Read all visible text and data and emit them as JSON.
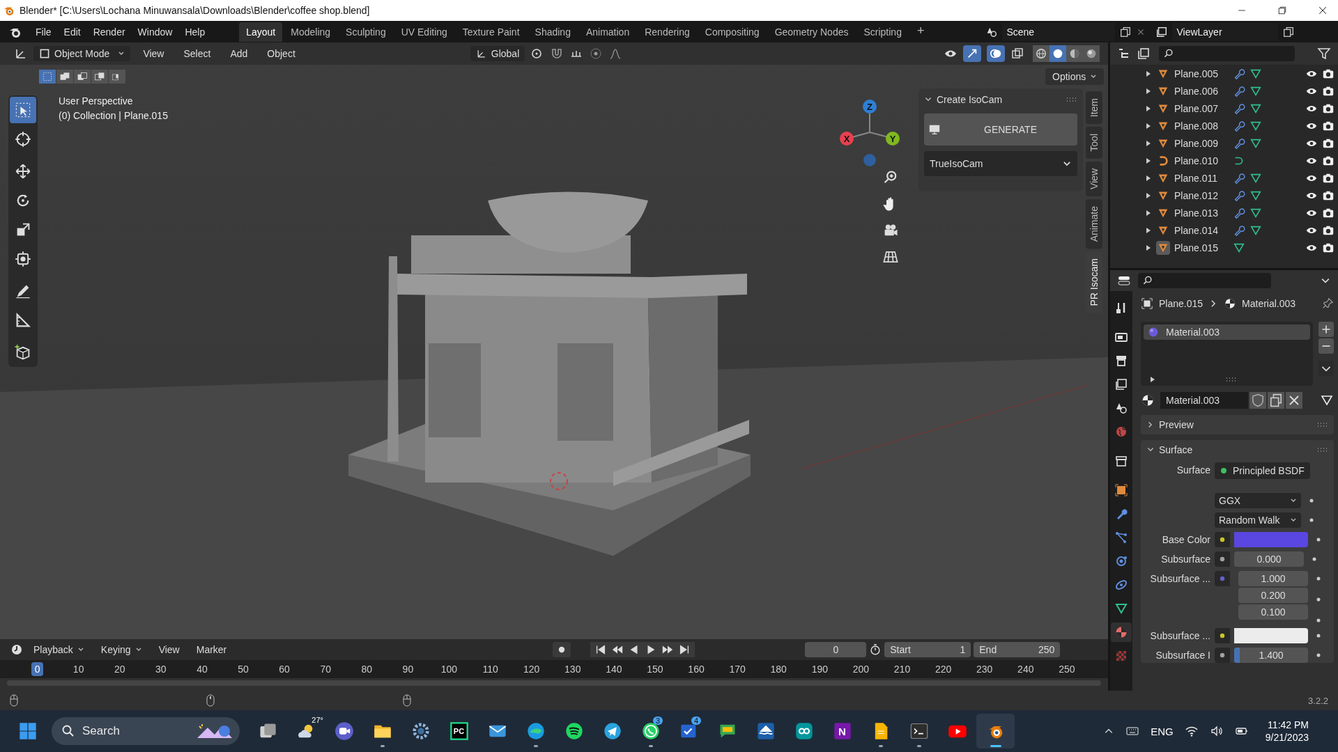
{
  "title_bar": {
    "title": "Blender* [C:\\Users\\Lochana Minuwansala\\Downloads\\Blender\\coffee shop.blend]"
  },
  "menu": [
    "File",
    "Edit",
    "Render",
    "Window",
    "Help"
  ],
  "workspaces": [
    {
      "label": "Layout",
      "selected": true
    },
    {
      "label": "Modeling",
      "selected": false
    },
    {
      "label": "Sculpting",
      "selected": false
    },
    {
      "label": "UV Editing",
      "selected": false
    },
    {
      "label": "Texture Paint",
      "selected": false
    },
    {
      "label": "Shading",
      "selected": false
    },
    {
      "label": "Animation",
      "selected": false
    },
    {
      "label": "Rendering",
      "selected": false
    },
    {
      "label": "Compositing",
      "selected": false
    },
    {
      "label": "Geometry Nodes",
      "selected": false
    },
    {
      "label": "Scripting",
      "selected": false
    }
  ],
  "add_workspace": "+",
  "scene": "Scene",
  "view_layer": "ViewLayer",
  "viewport_header": {
    "mode": "Object Mode",
    "menus": [
      "View",
      "Select",
      "Add",
      "Object"
    ],
    "orientation": "Global",
    "shading": [
      {
        "kind": "wireframe",
        "selected": false
      },
      {
        "kind": "solid",
        "selected": true
      },
      {
        "kind": "material",
        "selected": false
      },
      {
        "kind": "rendered",
        "selected": false
      }
    ]
  },
  "viewport": {
    "select_modes": [
      {
        "kind": "set",
        "selected": true
      },
      {
        "kind": "extend",
        "selected": false
      },
      {
        "kind": "subtract",
        "selected": false
      },
      {
        "kind": "invert",
        "selected": false
      },
      {
        "kind": "intersect",
        "selected": false
      }
    ],
    "options": "Options",
    "perspective": "User Perspective",
    "collection": "(0) Collection | Plane.015",
    "tools": [
      {
        "kind": "select",
        "selected": true
      },
      {
        "kind": "cursor",
        "selected": false
      },
      {
        "kind": "move",
        "selected": false
      },
      {
        "kind": "rotate",
        "selected": false
      },
      {
        "kind": "scale",
        "selected": false
      },
      {
        "kind": "transform",
        "selected": false
      },
      {
        "kind": "annotate",
        "selected": false
      },
      {
        "kind": "measure",
        "selected": false
      },
      {
        "kind": "add_cube",
        "selected": false
      }
    ],
    "gizmo_axes": [
      {
        "label": "Z",
        "color": "#2e7fd6"
      },
      {
        "label": "X",
        "color": "#e8404f"
      },
      {
        "label": "Y",
        "color": "#7fb81f"
      }
    ]
  },
  "sidebar_panel": {
    "title": "Create IsoCam",
    "expanded": true,
    "button": "GENERATE",
    "dropdown": "TrueIsoCam"
  },
  "sidebar_tabs": [
    {
      "label": "Item",
      "selected": false
    },
    {
      "label": "Tool",
      "selected": false
    },
    {
      "label": "View",
      "selected": false
    },
    {
      "label": "Animate",
      "selected": false
    },
    {
      "label": "PR Isocam",
      "selected": true
    }
  ],
  "outliner": [
    {
      "name": "Plane.005",
      "kind": "mesh",
      "modifier": true,
      "selected": false
    },
    {
      "name": "Plane.006",
      "kind": "mesh",
      "modifier": true,
      "selected": false
    },
    {
      "name": "Plane.007",
      "kind": "mesh",
      "modifier": true,
      "selected": false
    },
    {
      "name": "Plane.008",
      "kind": "mesh",
      "modifier": true,
      "selected": false
    },
    {
      "name": "Plane.009",
      "kind": "mesh",
      "modifier": true,
      "selected": false
    },
    {
      "name": "Plane.010",
      "kind": "curve",
      "modifier": false,
      "selected": false
    },
    {
      "name": "Plane.011",
      "kind": "mesh",
      "modifier": true,
      "selected": false
    },
    {
      "name": "Plane.012",
      "kind": "mesh",
      "modifier": true,
      "selected": false
    },
    {
      "name": "Plane.013",
      "kind": "mesh",
      "modifier": true,
      "selected": false
    },
    {
      "name": "Plane.014",
      "kind": "mesh",
      "modifier": true,
      "selected": false
    },
    {
      "name": "Plane.015",
      "kind": "mesh",
      "modifier": false,
      "selected": true
    }
  ],
  "properties": {
    "tabs": [
      {
        "kind": "tool",
        "selected": false
      },
      {
        "kind": "render",
        "selected": false
      },
      {
        "kind": "output",
        "selected": false
      },
      {
        "kind": "view_layer",
        "selected": false
      },
      {
        "kind": "scene",
        "selected": false
      },
      {
        "kind": "world",
        "selected": false
      },
      {
        "kind": "collection",
        "selected": false
      },
      {
        "kind": "object",
        "selected": false
      },
      {
        "kind": "modifiers",
        "selected": false
      },
      {
        "kind": "particles",
        "selected": false
      },
      {
        "kind": "physics",
        "selected": false
      },
      {
        "kind": "constraints",
        "selected": false
      },
      {
        "kind": "data",
        "selected": false
      },
      {
        "kind": "material",
        "selected": true
      },
      {
        "kind": "texture",
        "selected": false
      }
    ],
    "breadcrumb": [
      "Plane.015",
      "Material.003"
    ],
    "slots": [
      {
        "name": "Material.003",
        "selected": true
      }
    ],
    "material": "Material.003",
    "panels": [
      {
        "title": "Preview",
        "expanded": false
      },
      {
        "title": "Surface",
        "expanded": true
      }
    ],
    "shader_label": "Surface",
    "shader": "Principled BSDF",
    "dropdowns": [
      "GGX",
      "Random Walk"
    ],
    "inputs": [
      {
        "label": "Base Color",
        "kind": "color",
        "color": "#5a46e0"
      },
      {
        "label": "Subsurface",
        "kind": "float",
        "values": [
          "0.000"
        ]
      },
      {
        "label": "Subsurface ...",
        "kind": "vector",
        "values": [
          "1.000",
          "0.200",
          "0.100"
        ]
      },
      {
        "label": "Subsurface ...",
        "kind": "color",
        "color": "#ececec"
      },
      {
        "label": "Subsurface I",
        "kind": "slider",
        "values": [
          "1.400"
        ],
        "level": 0.08
      }
    ]
  },
  "timeline": {
    "menus": [
      "Playback",
      "Keying",
      "View",
      "Marker"
    ],
    "current_frame": "0",
    "start_label": "Start",
    "start": "1",
    "end_label": "End",
    "end": "250",
    "ticks": [
      {
        "label": "0",
        "selected": true
      },
      {
        "label": "10",
        "selected": false
      },
      {
        "label": "20",
        "selected": false
      },
      {
        "label": "30",
        "selected": false
      },
      {
        "label": "40",
        "selected": false
      },
      {
        "label": "50",
        "selected": false
      },
      {
        "label": "60",
        "selected": false
      },
      {
        "label": "70",
        "selected": false
      },
      {
        "label": "80",
        "selected": false
      },
      {
        "label": "90",
        "selected": false
      },
      {
        "label": "100",
        "selected": false
      },
      {
        "label": "110",
        "selected": false
      },
      {
        "label": "120",
        "selected": false
      },
      {
        "label": "130",
        "selected": false
      },
      {
        "label": "140",
        "selected": false
      },
      {
        "label": "150",
        "selected": false
      },
      {
        "label": "160",
        "selected": false
      },
      {
        "label": "170",
        "selected": false
      },
      {
        "label": "180",
        "selected": false
      },
      {
        "label": "190",
        "selected": false
      },
      {
        "label": "200",
        "selected": false
      },
      {
        "label": "210",
        "selected": false
      },
      {
        "label": "220",
        "selected": false
      },
      {
        "label": "230",
        "selected": false
      },
      {
        "label": "240",
        "selected": false
      },
      {
        "label": "250",
        "selected": false
      }
    ]
  },
  "status_bar": {
    "version": "3.2.2"
  },
  "taskbar": {
    "search": "Search",
    "weather": "27°",
    "apps": [
      {
        "kind": "taskview",
        "running": false,
        "selected": false
      },
      {
        "kind": "meet",
        "running": false,
        "selected": false
      },
      {
        "kind": "folder",
        "running": true,
        "selected": false
      },
      {
        "kind": "settings",
        "running": false,
        "selected": false
      },
      {
        "kind": "ide",
        "label": "PC",
        "running": false,
        "selected": false
      },
      {
        "kind": "mail",
        "running": false,
        "selected": false
      },
      {
        "kind": "browser",
        "running": true,
        "selected": false
      },
      {
        "kind": "music",
        "running": false,
        "selected": false
      },
      {
        "kind": "telegram",
        "running": false,
        "selected": false
      },
      {
        "kind": "whatsapp",
        "badge": "3",
        "running": true,
        "selected": false
      },
      {
        "kind": "todo",
        "badge": "4",
        "running": false,
        "selected": false
      },
      {
        "kind": "chat",
        "running": false,
        "selected": false
      },
      {
        "kind": "ship",
        "running": false,
        "selected": false
      },
      {
        "kind": "infinity",
        "running": false,
        "selected": false
      },
      {
        "kind": "notes",
        "label": "N",
        "running": false,
        "selected": false
      },
      {
        "kind": "file",
        "running": true,
        "selected": false
      },
      {
        "kind": "terminal",
        "running": true,
        "selected": false
      },
      {
        "kind": "video",
        "running": false,
        "selected": false
      },
      {
        "kind": "blender",
        "running": true,
        "selected": true
      }
    ],
    "language": "ENG",
    "time": "11:42 PM",
    "date": "9/21/2023"
  }
}
